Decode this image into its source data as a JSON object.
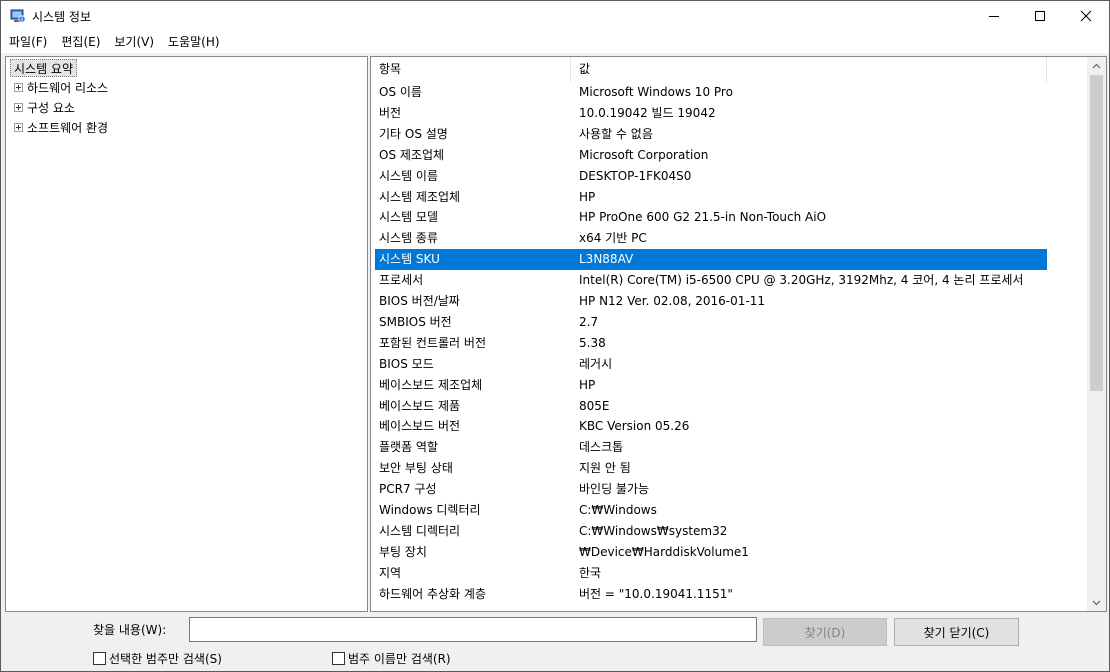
{
  "window": {
    "title": "시스템 정보",
    "controls": {
      "minimize_icon": "minimize-icon",
      "maximize_icon": "maximize-icon",
      "close_icon": "close-icon"
    }
  },
  "menu": [
    "파일(F)",
    "편집(E)",
    "보기(V)",
    "도움말(H)"
  ],
  "tree": {
    "root": "시스템 요약",
    "children": [
      "하드웨어 리소스",
      "구성 요소",
      "소프트웨어 환경"
    ]
  },
  "list": {
    "columns": [
      "항목",
      "값"
    ],
    "rows": [
      {
        "k": "OS 이름",
        "v": "Microsoft Windows 10 Pro"
      },
      {
        "k": "버전",
        "v": "10.0.19042 빌드 19042"
      },
      {
        "k": "기타 OS 설명",
        "v": "사용할 수 없음"
      },
      {
        "k": "OS 제조업체",
        "v": "Microsoft Corporation"
      },
      {
        "k": "시스템 이름",
        "v": "DESKTOP-1FK04S0"
      },
      {
        "k": "시스템 제조업체",
        "v": "HP"
      },
      {
        "k": "시스템 모델",
        "v": "HP ProOne 600 G2 21.5-in Non-Touch AiO"
      },
      {
        "k": "시스템 종류",
        "v": "x64 기반 PC"
      },
      {
        "k": "시스템 SKU",
        "v": "L3N88AV"
      },
      {
        "k": "프로세서",
        "v": "Intel(R) Core(TM) i5-6500 CPU @ 3.20GHz, 3192Mhz, 4 코어, 4 논리 프로세서"
      },
      {
        "k": "BIOS 버전/날짜",
        "v": "HP N12 Ver. 02.08, 2016-01-11"
      },
      {
        "k": "SMBIOS 버전",
        "v": "2.7"
      },
      {
        "k": "포함된 컨트롤러 버전",
        "v": "5.38"
      },
      {
        "k": "BIOS 모드",
        "v": "레거시"
      },
      {
        "k": "베이스보드 제조업체",
        "v": "HP"
      },
      {
        "k": "베이스보드 제품",
        "v": "805E"
      },
      {
        "k": "베이스보드 버전",
        "v": "KBC Version 05.26"
      },
      {
        "k": "플랫폼 역할",
        "v": "데스크톱"
      },
      {
        "k": "보안 부팅 상태",
        "v": "지원 안 됨"
      },
      {
        "k": "PCR7 구성",
        "v": "바인딩 불가능"
      },
      {
        "k": "Windows 디렉터리",
        "v": "C:₩Windows"
      },
      {
        "k": "시스템 디렉터리",
        "v": "C:₩Windows₩system32"
      },
      {
        "k": "부팅 장치",
        "v": "₩Device₩HarddiskVolume1"
      },
      {
        "k": "지역",
        "v": "한국"
      },
      {
        "k": "하드웨어 추상화 계층",
        "v": "버전 = \"10.0.19041.1151\""
      }
    ],
    "selected_index": 8,
    "selected_color": "#0078d7"
  },
  "find": {
    "label": "찾을 내용(W):",
    "value": "",
    "find_button": "찾기(D)",
    "close_button": "찾기 닫기(C)",
    "check_selected_category": "선택한 범주만 검색(S)",
    "check_category_names": "범주 이름만 검색(R)"
  }
}
